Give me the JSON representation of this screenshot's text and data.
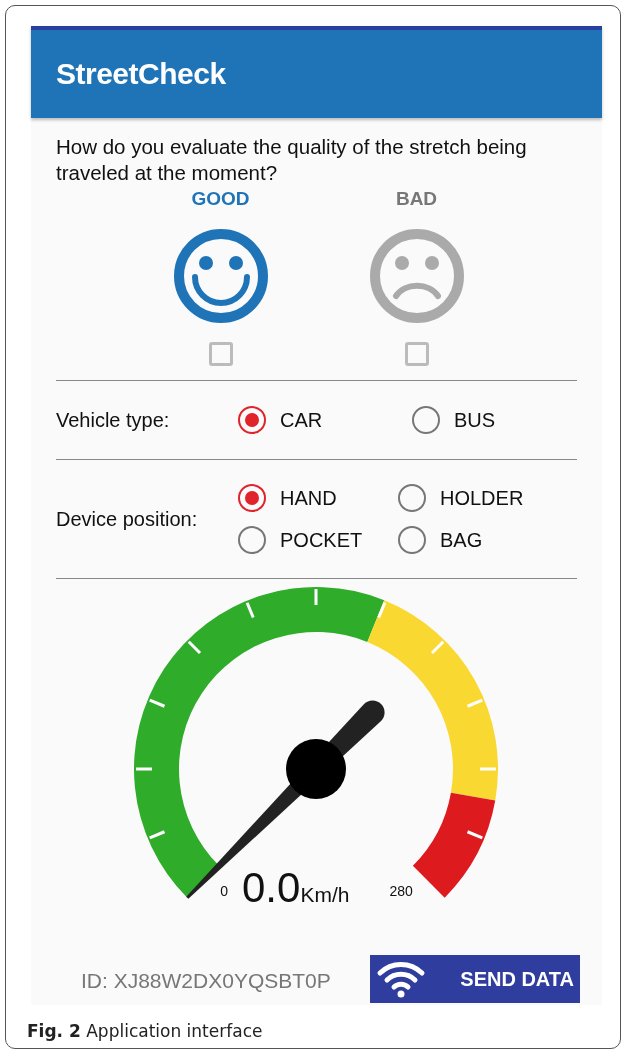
{
  "app_bar": {
    "title": "StreetCheck"
  },
  "question": {
    "text": "How do you evaluate the quality of the stretch being traveled at the moment?",
    "options": [
      {
        "label": "GOOD",
        "kind": "happy",
        "selected": true,
        "checked": false
      },
      {
        "label": "BAD",
        "kind": "sad",
        "selected": false,
        "checked": false
      }
    ]
  },
  "vehicle_type": {
    "label": "Vehicle type:",
    "options": [
      {
        "label": "CAR",
        "selected": true
      },
      {
        "label": "BUS",
        "selected": false
      }
    ]
  },
  "device_position": {
    "label": "Device position:",
    "options": [
      {
        "label": "HAND",
        "selected": true
      },
      {
        "label": "HOLDER",
        "selected": false
      },
      {
        "label": "POCKET",
        "selected": false
      },
      {
        "label": "BAG",
        "selected": false
      }
    ]
  },
  "speedometer": {
    "min": "0",
    "max": "280",
    "reading": "0.0",
    "unit": "Km/h"
  },
  "footer": {
    "id": "ID: XJ88W2DX0YQSBT0P",
    "button": "SEND DATA"
  },
  "caption": {
    "label": "Fig. 2",
    "text": "Application interface"
  }
}
